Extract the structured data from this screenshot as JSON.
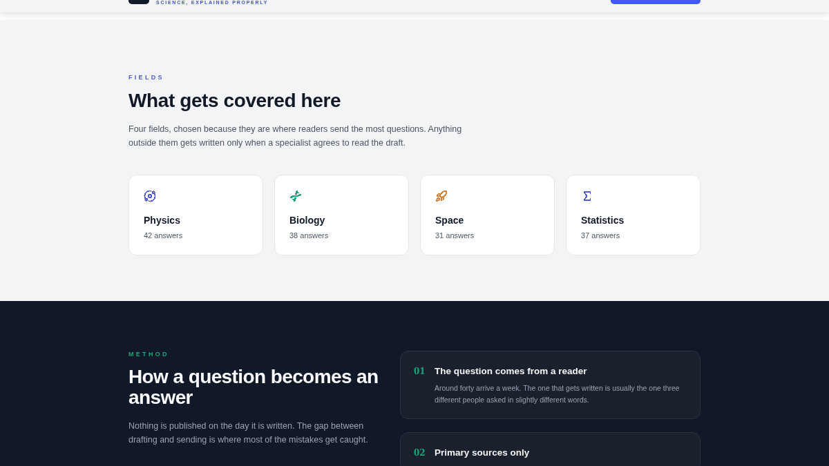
{
  "header": {
    "tagline": "SCIENCE, EXPLAINED PROPERLY"
  },
  "fields": {
    "eyebrow": "FIELDS",
    "title": "What gets covered here",
    "intro": "Four fields, chosen because they are where readers send the most questions. Anything outside them gets written only when a specialist agrees to read the draft.",
    "cards": [
      {
        "name": "Physics",
        "count": "42 answers",
        "color": "#4f5bd5"
      },
      {
        "name": "Biology",
        "count": "38 answers",
        "color": "#1fa37a"
      },
      {
        "name": "Space",
        "count": "31 answers",
        "color": "#d4843a"
      },
      {
        "name": "Statistics",
        "count": "37 answers",
        "color": "#4f5bd5"
      }
    ]
  },
  "method": {
    "eyebrow": "METHOD",
    "title": "How a question becomes an answer",
    "intro": "Nothing is published on the day it is written. The gap between drafting and sending is where most of the mistakes get caught.",
    "steps": [
      {
        "number": "01",
        "title": "The question comes from a reader",
        "description": "Around forty arrive a week. The one that gets written is usually the one three different people asked in slightly different words."
      },
      {
        "number": "02",
        "title": "Primary sources only"
      }
    ]
  }
}
